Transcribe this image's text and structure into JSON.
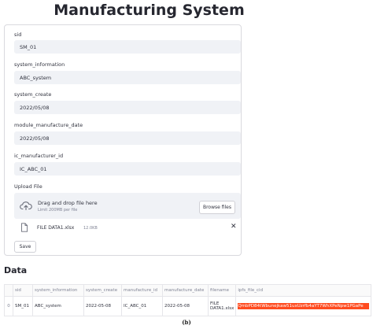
{
  "app": {
    "title": "Manufacturing System"
  },
  "form": {
    "fields": [
      {
        "label": "sid",
        "value": "SM_01"
      },
      {
        "label": "system_information",
        "value": "ABC_system"
      },
      {
        "label": "system_create",
        "value": "2022/05/08"
      },
      {
        "label": "module_manufacture_date",
        "value": "2022/05/08"
      },
      {
        "label": "ic_manufacturer_id",
        "value": "IC_ABC_01"
      }
    ],
    "upload": {
      "label": "Upload File",
      "dropzone_title": "Drag and drop file here",
      "dropzone_limit": "Limit 200MB per file",
      "browse_label": "Browse files",
      "file_name": "FILE DATA1.xlsx",
      "file_size": "12.0KB",
      "remove_glyph": "✕"
    },
    "save_label": "Save"
  },
  "data_section": {
    "heading": "Data",
    "columns": [
      "",
      "sid",
      "system_information",
      "system_create",
      "manufacture_id",
      "manufacture_date",
      "filename",
      "ipfs_file_cid"
    ],
    "row": {
      "index": "0",
      "sid": "SM_01",
      "system_information": "ABC_system",
      "system_create": "2022-05-08",
      "manufacture_id": "IC_ABC_01",
      "manufacture_date": "2022-05-08",
      "filename_line1": "FILE",
      "filename_line2": "DATA1.xlsx",
      "ipfs_file_cid": "QmbPD84tWbunejkaw51uxUzrfb4aYT7WhXPeNpw1PGaPe"
    },
    "highlight_color": "#ff4b1f"
  },
  "caption": "(b)"
}
